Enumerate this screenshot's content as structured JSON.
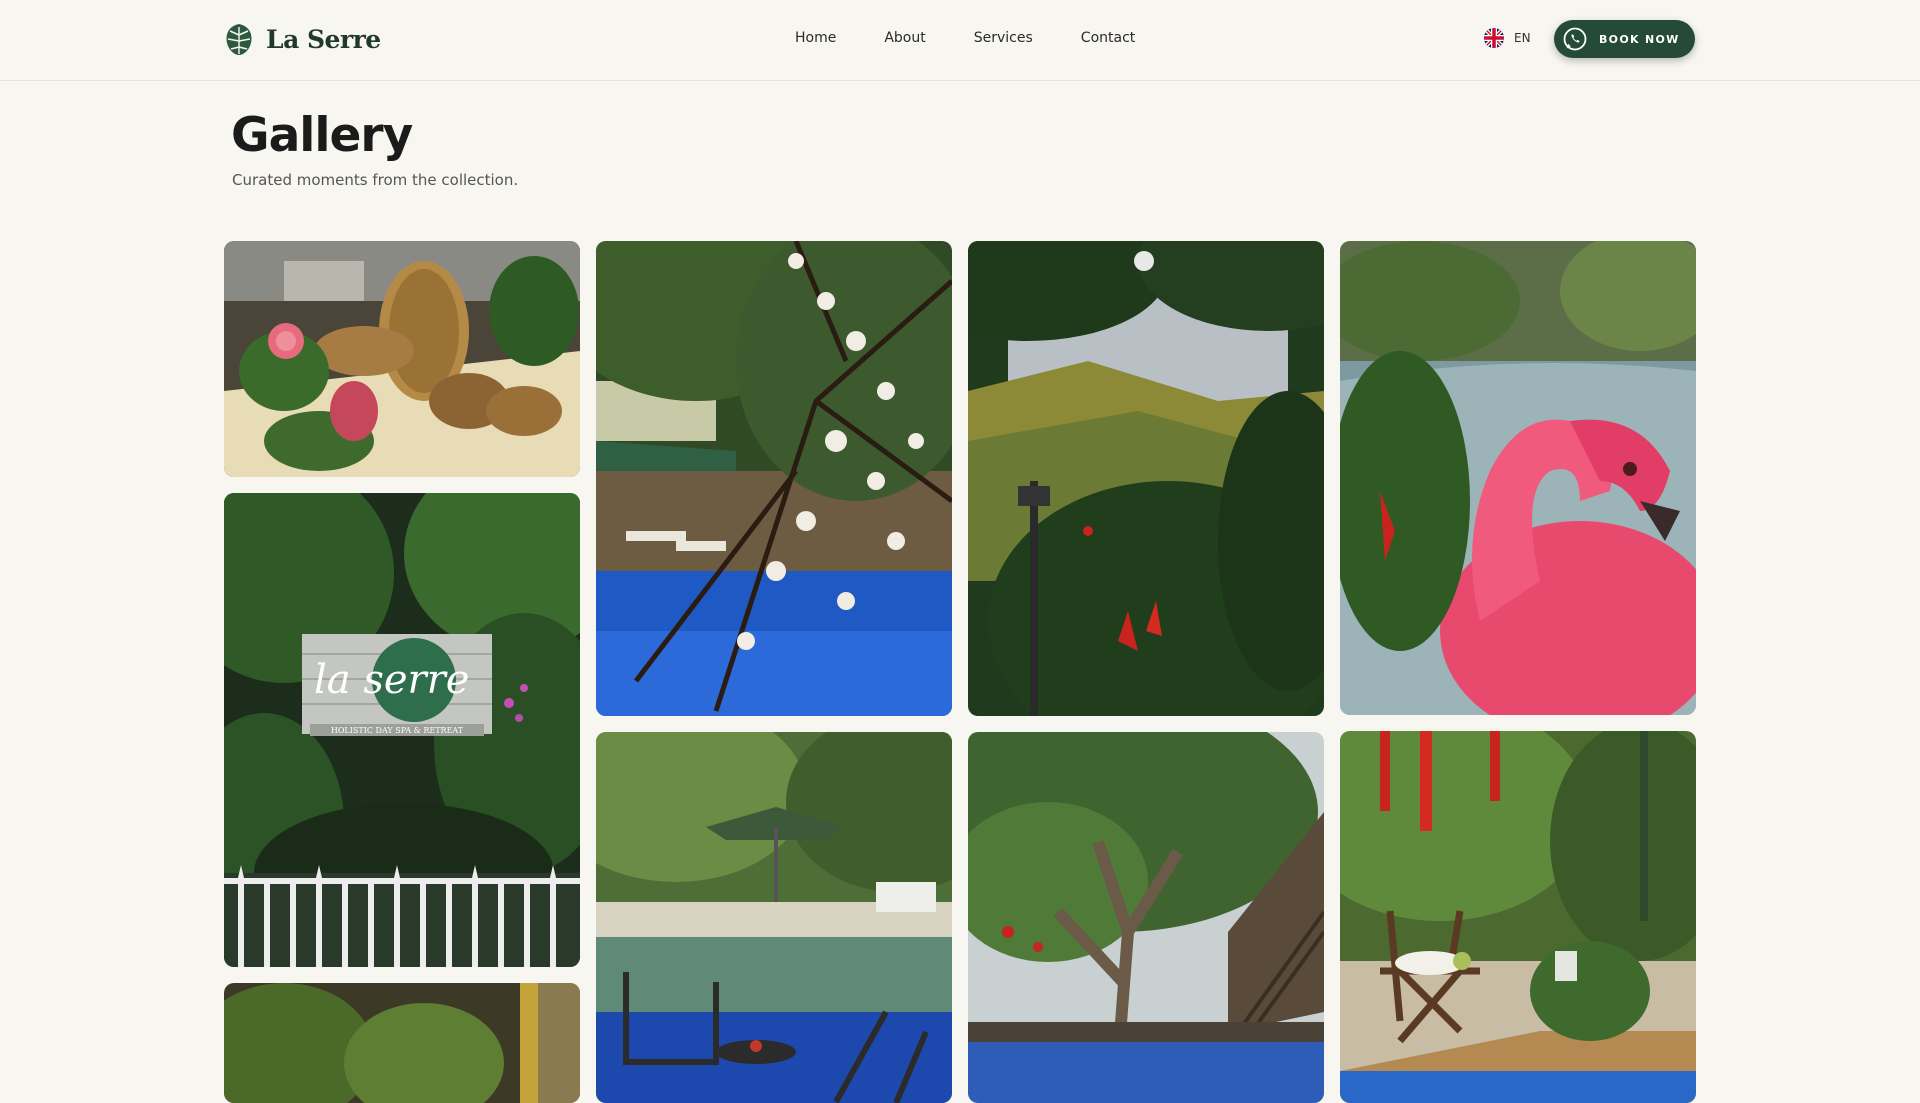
{
  "brand": {
    "name": "La Serre"
  },
  "nav": {
    "items": [
      "Home",
      "About",
      "Services",
      "Contact"
    ]
  },
  "language": {
    "code": "EN"
  },
  "cta": {
    "label": "BOOK NOW"
  },
  "gallery": {
    "title": "Gallery",
    "subtitle": "Curated moments from the collection.",
    "sign": {
      "script": "la serre",
      "tagline": "HOLISTIC DAY SPA & RETREAT"
    }
  },
  "colors": {
    "brand_green": "#254a36",
    "background": "#f7f6f1"
  }
}
